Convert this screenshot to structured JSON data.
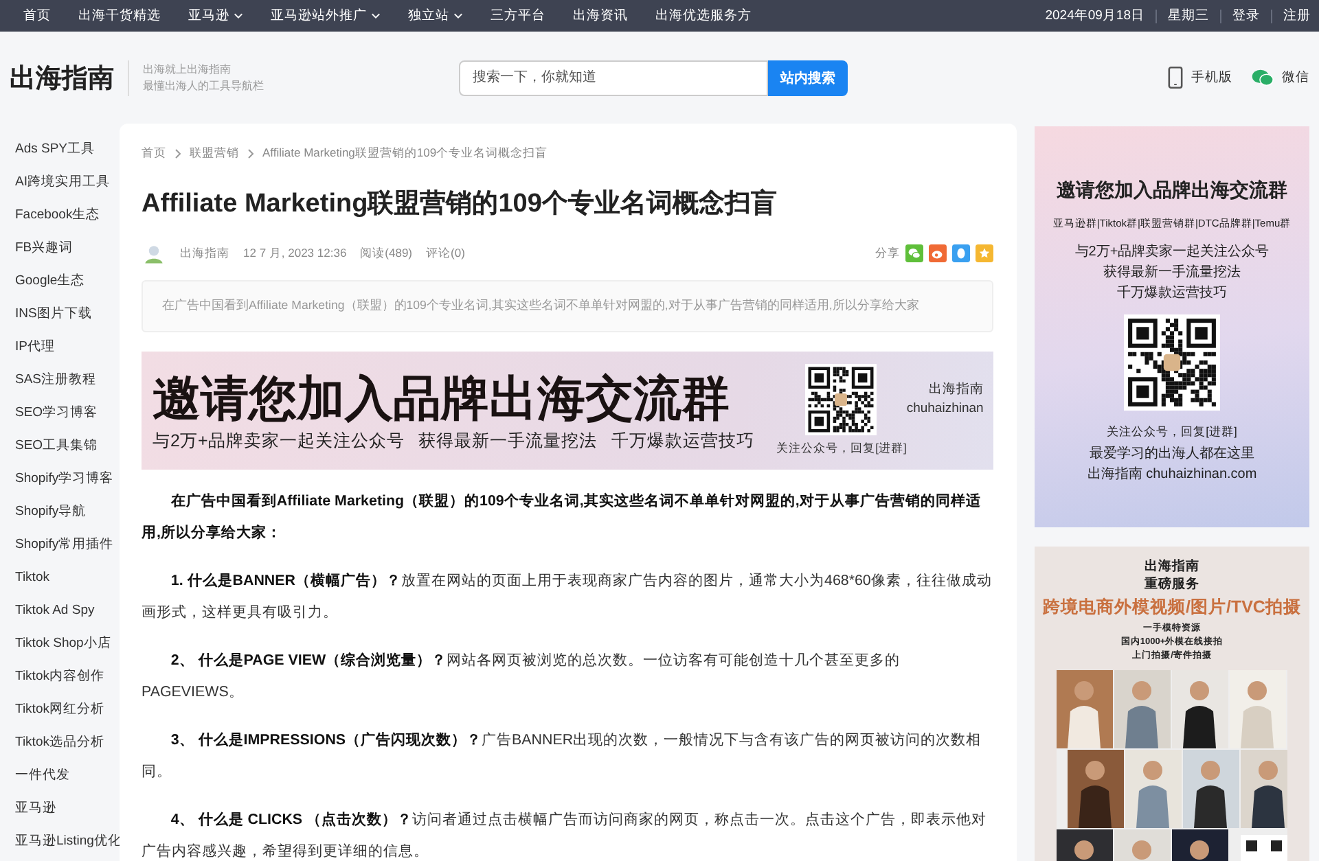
{
  "top_nav": {
    "items": [
      {
        "label": "首页",
        "has_menu": false
      },
      {
        "label": "出海干货精选",
        "has_menu": false
      },
      {
        "label": "亚马逊",
        "has_menu": true
      },
      {
        "label": "亚马逊站外推广",
        "has_menu": true
      },
      {
        "label": "独立站",
        "has_menu": true
      },
      {
        "label": "三方平台",
        "has_menu": false
      },
      {
        "label": "出海资讯",
        "has_menu": false
      },
      {
        "label": "出海优选服务方",
        "has_menu": false
      }
    ],
    "date": "2024年09月18日",
    "weekday": "星期三",
    "links": [
      "登录",
      "注册"
    ]
  },
  "header": {
    "logo": "出海指南",
    "tagline": [
      "出海就上出海指南",
      "最懂出海人的工具导航栏"
    ],
    "search": {
      "placeholder": "搜索一下，你就知道",
      "button": "站内搜索"
    },
    "mobile": "手机版",
    "wechat": "微信"
  },
  "sidebar": {
    "items": [
      "Ads SPY工具",
      "AI跨境实用工具",
      "Facebook生态",
      "FB兴趣词",
      "Google生态",
      "INS图片下载",
      "IP代理",
      "SAS注册教程",
      "SEO学习博客",
      "SEO工具集锦",
      "Shopify学习博客",
      "Shopify导航",
      "Shopify常用插件",
      "Tiktok",
      "Tiktok Ad Spy",
      "Tiktok Shop小店",
      "Tiktok内容创作",
      "Tiktok网红分析",
      "Tiktok选品分析",
      "一件代发",
      "亚马逊",
      "亚马逊Listing优化"
    ]
  },
  "article": {
    "breadcrumbs": [
      "首页",
      "联盟营销",
      "Affiliate Marketing联盟营销的109个专业名词概念扫盲"
    ],
    "title": "Affiliate Marketing联盟营销的109个专业名词概念扫盲",
    "meta": {
      "author": "出海指南",
      "date": "12 7 月, 2023 12:36",
      "reads": "阅读(489)",
      "comments": "评论(0)"
    },
    "share_label": "分享",
    "summary": "在广告中国看到Affiliate Marketing（联盟）的109个专业名词,其实这些名词不单单针对网盟的,对于从事广告营销的同样适用,所以分享给大家",
    "banner": {
      "headline": "邀请您加入品牌出海交流群",
      "subline": "与2万+品牌卖家一起关注公众号   获得最新一手流量挖法   千万爆款运营技巧",
      "account_name": "出海指南",
      "account_id": "chuhaizhinan",
      "qr_caption": "关注公众号，回复[进群]"
    },
    "paragraphs": [
      "**在广告中国看到Affiliate Marketing（联盟）的109个专业名词,其实这些名词不单单针对网盟的,对于从事广告营销的同样适用,所以分享给大家：**",
      "**1. 什么是BANNER（横幅广告）？**放置在网站的页面上用于表现商家广告内容的图片，通常大小为468*60像素，往往做成动画形式，这样更具有吸引力。",
      "**2、 什么是PAGE VIEW（综合浏览量）？**网站各网页被浏览的总次数。一位访客有可能创造十几个甚至更多的PAGEVIEWS。",
      "**3、 什么是IMPRESSIONS（广告闪现次数）？**广告BANNER出现的次数，一般情况下与含有该广告的网页被访问的次数相同。",
      "**4、 什么是 CLICKS （点击次数）？**访问者通过点击横幅广告而访问商家的网页，称点击一次。点击这个广告，即表示他对广告内容感兴趣，希望得到更详细的信息。"
    ]
  },
  "ads": [
    {
      "title": "邀请您加入品牌出海交流群",
      "groups": "亚马逊群|Tiktok群|联盟营销群|DTC品牌群|Temu群",
      "lines": [
        "与2万+品牌卖家一起关注公众号",
        "获得最新一手流量挖法",
        "千万爆款运营技巧"
      ],
      "qr_caption": "关注公众号，回复[进群]",
      "slogan": "最爱学习的出海人都在这里",
      "site": "出海指南 chuhaizhinan.com"
    },
    {
      "brand": "出海指南",
      "service": "重磅服务",
      "headline": "跨境电商外模视频/图片/TVC拍摄",
      "lines": [
        "一手模特资源",
        "国内1000+外模在线接拍",
        "上门拍摄/寄件拍摄"
      ]
    }
  ]
}
